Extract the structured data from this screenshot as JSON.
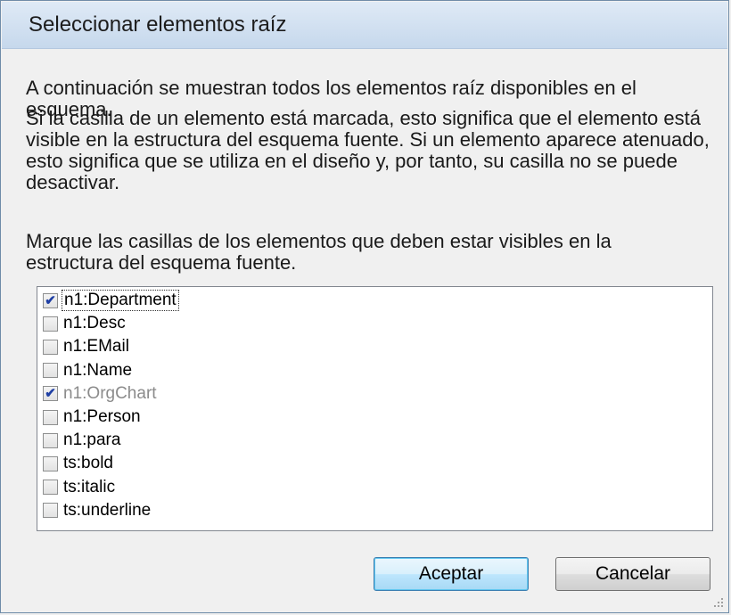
{
  "window": {
    "title": "Seleccionar elementos raíz"
  },
  "text": {
    "intro": "A continuación se muestran todos los elementos raíz disponibles en el esquema.",
    "description": "Si la casilla de un elemento está marcada, esto significa que el elemento está visible en la estructura del esquema fuente. Si un elemento aparece atenuado, esto significa que se utiliza en el diseño y, por tanto, su casilla no se puede desactivar.",
    "instruction": "Marque las casillas de los elementos que deben estar visibles en la estructura del esquema fuente."
  },
  "elements": [
    {
      "label": "n1:Department",
      "checked": true,
      "disabled": false,
      "focused": true
    },
    {
      "label": "n1:Desc",
      "checked": false,
      "disabled": false,
      "focused": false
    },
    {
      "label": "n1:EMail",
      "checked": false,
      "disabled": false,
      "focused": false
    },
    {
      "label": "n1:Name",
      "checked": false,
      "disabled": false,
      "focused": false
    },
    {
      "label": "n1:OrgChart",
      "checked": true,
      "disabled": true,
      "focused": false
    },
    {
      "label": "n1:Person",
      "checked": false,
      "disabled": false,
      "focused": false
    },
    {
      "label": "n1:para",
      "checked": false,
      "disabled": false,
      "focused": false
    },
    {
      "label": "ts:bold",
      "checked": false,
      "disabled": false,
      "focused": false
    },
    {
      "label": "ts:italic",
      "checked": false,
      "disabled": false,
      "focused": false
    },
    {
      "label": "ts:underline",
      "checked": false,
      "disabled": false,
      "focused": false
    }
  ],
  "buttons": {
    "ok": "Aceptar",
    "cancel": "Cancelar"
  },
  "icons": {
    "check": "checkmark-icon",
    "grip": "resize-grip-icon"
  }
}
